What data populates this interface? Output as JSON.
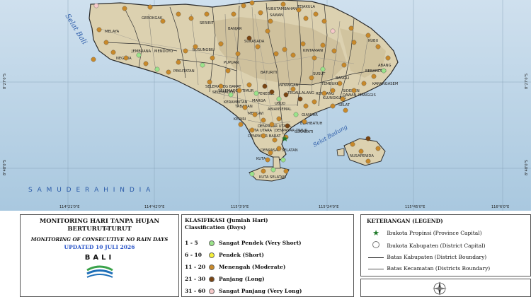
{
  "map": {
    "sea_labels": {
      "west": "Selat Bali",
      "south": "S A M U D E R A   H I N D I A",
      "badung": "Selat Badung"
    },
    "lat_labels": [
      "8°27'0\"S",
      "8°48'0\"S"
    ],
    "lon_labels": [
      "114°21'0\"E",
      "114°42'0\"E",
      "115°3'0\"E",
      "115°24'0\"E",
      "115°45'0\"E",
      "116°6'0\"E"
    ],
    "districts": [
      {
        "name": "GEROKGAK"
      },
      {
        "name": "SERIRIT"
      },
      {
        "name": "BANJAR"
      },
      {
        "name": "SUKASADA"
      },
      {
        "name": "KUBUTAMBAHAN"
      },
      {
        "name": "TEJAKULA"
      },
      {
        "name": "SAWAN"
      },
      {
        "name": "KINTAMANI"
      },
      {
        "name": "MELAYA"
      },
      {
        "name": "JEMBRANA"
      },
      {
        "name": "MENDOYO"
      },
      {
        "name": "NEGARA"
      },
      {
        "name": "BUSUNGBIU"
      },
      {
        "name": "PUPUAN"
      },
      {
        "name": "KUBU"
      },
      {
        "name": "PEKUTATAN"
      },
      {
        "name": "BATURITI"
      },
      {
        "name": "PENEBEL"
      },
      {
        "name": "PAYANGAN"
      },
      {
        "name": "TEGALLALANG"
      },
      {
        "name": "BANGLI"
      },
      {
        "name": "SUSUT"
      },
      {
        "name": "TEMBUKU"
      },
      {
        "name": "RENDANG"
      },
      {
        "name": "BEBANDEM"
      },
      {
        "name": "ABANG"
      },
      {
        "name": "SELEMADEG BARAT"
      },
      {
        "name": "SELEMADEG"
      },
      {
        "name": "SELEMADEG TIMUR"
      },
      {
        "name": "KERAMBITAN"
      },
      {
        "name": "TABANAN"
      },
      {
        "name": "MARGA"
      },
      {
        "name": "KEDIRI"
      },
      {
        "name": "MENGWI"
      },
      {
        "name": "ABIANSEMAL"
      },
      {
        "name": "UBUD"
      },
      {
        "name": "GIANYAR"
      },
      {
        "name": "SIDEMEN"
      },
      {
        "name": "SELAT"
      },
      {
        "name": "KARANGASEM"
      },
      {
        "name": "MANGGIS"
      },
      {
        "name": "DAWAN"
      },
      {
        "name": "KLUNGKUNG"
      },
      {
        "name": "BLAHBATUH"
      },
      {
        "name": "SUKAWATI"
      },
      {
        "name": "KUTA UTARA"
      },
      {
        "name": "DENPASAR UTARA"
      },
      {
        "name": "DENPASAR BARAT"
      },
      {
        "name": "DENPASAR TIMUR"
      },
      {
        "name": "DENPASAR SELATAN"
      },
      {
        "name": "KUTA"
      },
      {
        "name": "KUTA SELATAN"
      },
      {
        "name": "NUSAPENIDA"
      }
    ]
  },
  "title": {
    "line1": "MONITORING HARI TANPA HUJAN",
    "line2": "BERTURUT-TURUT",
    "subtitle": "MONITORING OF CONSECUTIVE NO RAIN DAYS",
    "updated": "UPDATED 10 JULI 2026",
    "region": "BALI"
  },
  "classification": {
    "header1": "KLASIFIKASI (Jumlah Hari)",
    "header2": "Classification (Days)",
    "rows": [
      {
        "range": "1 - 5",
        "label": "Sangat Pendek  (Very Short)",
        "color": "#9be38a"
      },
      {
        "range": "6 - 10",
        "label": "Pendek  (Short)",
        "color": "#f5f03a"
      },
      {
        "range": "11 - 20",
        "label": "Menengah  (Moderate)",
        "color": "#c8892a"
      },
      {
        "range": "21 - 30",
        "label": "Panjang  (Long)",
        "color": "#7a4512"
      },
      {
        "range": "31 - 60",
        "label": "Sangat Panjang  (Very Long)",
        "color": "#f6c9c9"
      }
    ]
  },
  "legend": {
    "title": "KETERANGAN  (LEGEND)",
    "items": [
      {
        "label": "Ibukota Propinsi (Province Capital)"
      },
      {
        "label": "Ibukota Kabupaten (District Capital)"
      },
      {
        "label": "Batas Kabupaten (District Boundary)"
      },
      {
        "label": "Batas Kecamatan (Districts Boundary)"
      }
    ]
  },
  "colors": {
    "sea": "#b8d3e6",
    "land": "#dcd1b0",
    "highland": "#c9bb95",
    "moderate": "#c8892a",
    "long": "#7a4512",
    "very_short": "#9be38a",
    "short": "#f5f03a",
    "very_long": "#f6c9c9"
  },
  "icons": {
    "compass": "compass-rose-icon",
    "bmkg": "bmkg-logo-icon",
    "province_capital": "green-star-icon"
  }
}
